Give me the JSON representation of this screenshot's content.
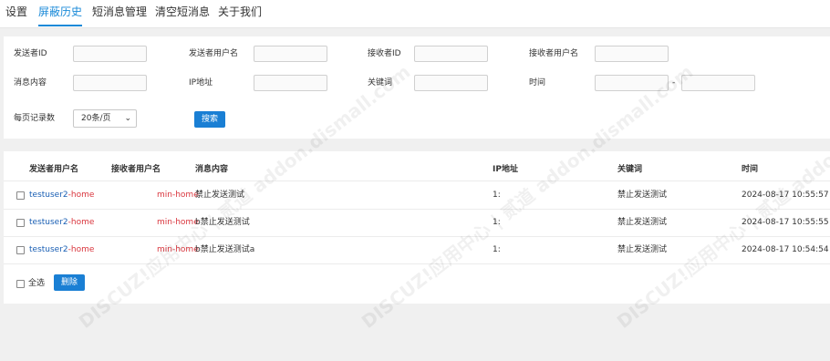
{
  "nav": {
    "tabs": [
      {
        "label": "设置",
        "active": false
      },
      {
        "label": "屏蔽历史",
        "active": true
      },
      {
        "label": "短消息管理",
        "active": false
      },
      {
        "label": "清空短消息",
        "active": false
      },
      {
        "label": "关于我们",
        "active": false
      }
    ]
  },
  "search": {
    "sender_id_label": "发送者ID",
    "sender_name_label": "发送者用户名",
    "receiver_id_label": "接收者ID",
    "receiver_name_label": "接收者用户名",
    "content_label": "消息内容",
    "ip_label": "IP地址",
    "keyword_label": "关键词",
    "time_label": "时间",
    "time_separator": "-",
    "per_page_label": "每页记录数",
    "per_page_value": "20条/页",
    "search_button": "搜索"
  },
  "table": {
    "headers": [
      "发送者用户名",
      "接收者用户名",
      "消息内容",
      "IP地址",
      "关键词",
      "时间"
    ],
    "rows": [
      {
        "sender_prefix": "testuser2",
        "sender_suffix": "-home",
        "receiver": "min-home",
        "content": "禁止发送测试",
        "ip": "1:",
        "keyword": "禁止发送测试",
        "time": "2024-08-17 10:55:57"
      },
      {
        "sender_prefix": "testuser2",
        "sender_suffix": "-home",
        "receiver": "min-home",
        "content": "b禁止发送测试",
        "ip": "1:",
        "keyword": "禁止发送测试",
        "time": "2024-08-17 10:55:55"
      },
      {
        "sender_prefix": "testuser2",
        "sender_suffix": "-home",
        "receiver": "min-home",
        "content": "b禁止发送测试a",
        "ip": "1:",
        "keyword": "禁止发送测试",
        "time": "2024-08-17 10:54:54"
      }
    ],
    "select_all_label": "全选",
    "delete_button": "删除"
  },
  "watermark": {
    "text": "DISCUZ!应用中心 | 贰道 addon.dismall.com"
  }
}
